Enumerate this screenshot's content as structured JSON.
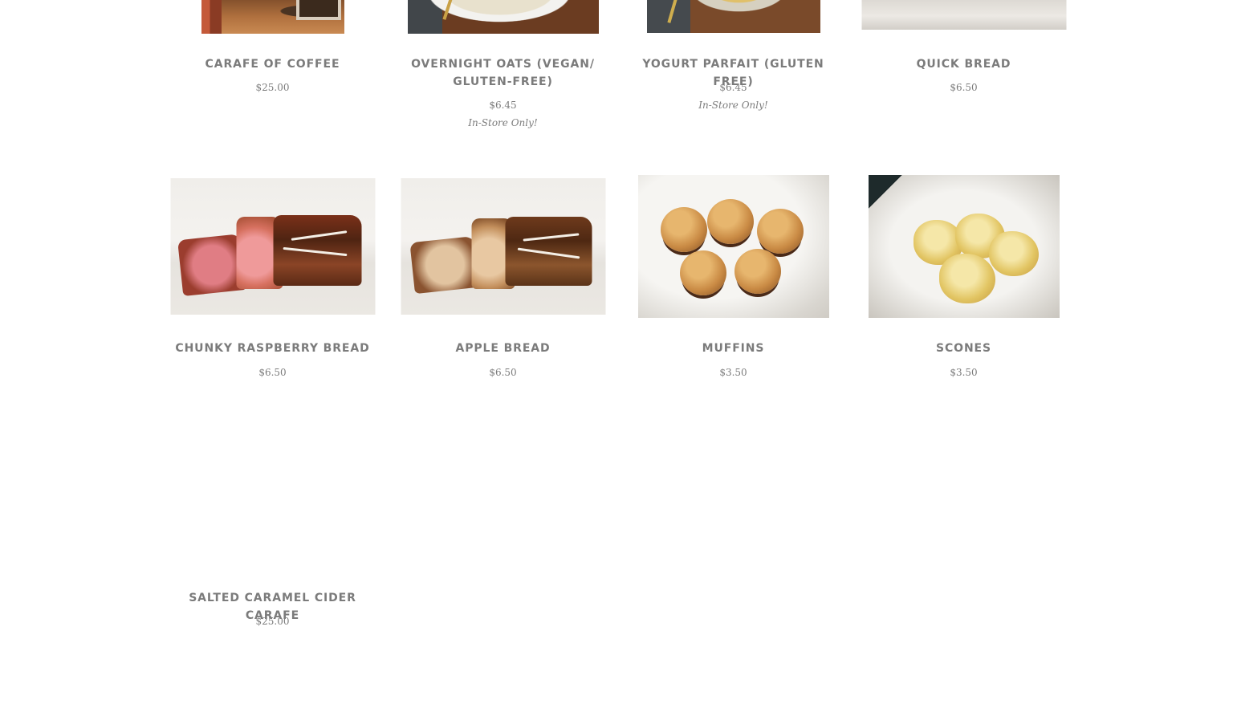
{
  "products": [
    {
      "title": "Carafe of Coffee",
      "price": "$25.00",
      "note": ""
    },
    {
      "title": "Overnight Oats (Vegan/ Gluten-Free)",
      "price": "$6.45",
      "note": "In-Store Only!"
    },
    {
      "title": "Yogurt Parfait (Gluten Free)",
      "price": "$6.45",
      "note": "In-Store Only!"
    },
    {
      "title": "Quick Bread",
      "price": "$6.50",
      "note": ""
    },
    {
      "title": "Chunky Raspberry Bread",
      "price": "$6.50",
      "note": ""
    },
    {
      "title": "Apple Bread",
      "price": "$6.50",
      "note": ""
    },
    {
      "title": "Muffins",
      "price": "$3.50",
      "note": ""
    },
    {
      "title": "Scones",
      "price": "$3.50",
      "note": ""
    },
    {
      "title": "Salted Caramel Cider Carafe",
      "price": "$25.00",
      "note": ""
    }
  ]
}
